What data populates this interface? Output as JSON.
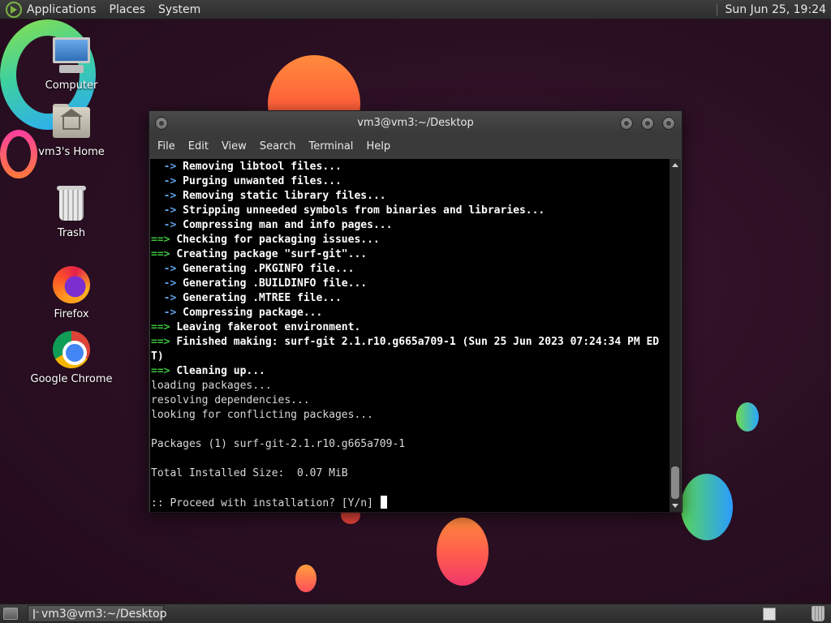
{
  "top_panel": {
    "menus": [
      "Applications",
      "Places",
      "System"
    ],
    "clock": "Sun Jun 25, 19:24"
  },
  "desktop_icons": [
    {
      "label": "Computer",
      "icon": "computer-icon"
    },
    {
      "label": "vm3's Home",
      "icon": "home-folder-icon"
    },
    {
      "label": "Trash",
      "icon": "trash-icon"
    },
    {
      "label": "Firefox",
      "icon": "firefox-icon"
    },
    {
      "label": "Google Chrome",
      "icon": "chrome-icon"
    }
  ],
  "terminal": {
    "title": "vm3@vm3:~/Desktop",
    "menu": [
      "File",
      "Edit",
      "View",
      "Search",
      "Terminal",
      "Help"
    ],
    "lines": [
      {
        "prefix": "  -> ",
        "style": "blue",
        "text": "Removing libtool files..."
      },
      {
        "prefix": "  -> ",
        "style": "blue",
        "text": "Purging unwanted files..."
      },
      {
        "prefix": "  -> ",
        "style": "blue",
        "text": "Removing static library files..."
      },
      {
        "prefix": "  -> ",
        "style": "blue",
        "text": "Stripping unneeded symbols from binaries and libraries..."
      },
      {
        "prefix": "  -> ",
        "style": "blue",
        "text": "Compressing man and info pages..."
      },
      {
        "prefix": "==> ",
        "style": "green",
        "text": "Checking for packaging issues..."
      },
      {
        "prefix": "==> ",
        "style": "green",
        "text": "Creating package \"surf-git\"..."
      },
      {
        "prefix": "  -> ",
        "style": "blue",
        "text": "Generating .PKGINFO file..."
      },
      {
        "prefix": "  -> ",
        "style": "blue",
        "text": "Generating .BUILDINFO file..."
      },
      {
        "prefix": "  -> ",
        "style": "blue",
        "text": "Generating .MTREE file..."
      },
      {
        "prefix": "  -> ",
        "style": "blue",
        "text": "Compressing package..."
      },
      {
        "prefix": "==> ",
        "style": "green",
        "text": "Leaving fakeroot environment."
      },
      {
        "prefix": "==> ",
        "style": "green",
        "text": "Finished making: surf-git 2.1.r10.g665a709-1 (Sun 25 Jun 2023 07:24:34 PM ED"
      },
      {
        "prefix": "",
        "style": "bold",
        "text": "T)"
      },
      {
        "prefix": "==> ",
        "style": "green",
        "text": "Cleaning up..."
      },
      {
        "prefix": "",
        "style": "plain",
        "text": "loading packages..."
      },
      {
        "prefix": "",
        "style": "plain",
        "text": "resolving dependencies..."
      },
      {
        "prefix": "",
        "style": "plain",
        "text": "looking for conflicting packages..."
      },
      {
        "prefix": "",
        "style": "plain",
        "text": ""
      },
      {
        "prefix": "",
        "style": "plain",
        "text": "Packages (1) surf-git-2.1.r10.g665a709-1"
      },
      {
        "prefix": "",
        "style": "plain",
        "text": ""
      },
      {
        "prefix": "",
        "style": "plain",
        "text": "Total Installed Size:  0.07 MiB"
      },
      {
        "prefix": "",
        "style": "plain",
        "text": ""
      },
      {
        "prefix": "",
        "style": "prompt",
        "text": ":: Proceed with installation? [Y/n] "
      }
    ]
  },
  "taskbar": {
    "task_label": "vm3@vm3:~/Desktop"
  }
}
